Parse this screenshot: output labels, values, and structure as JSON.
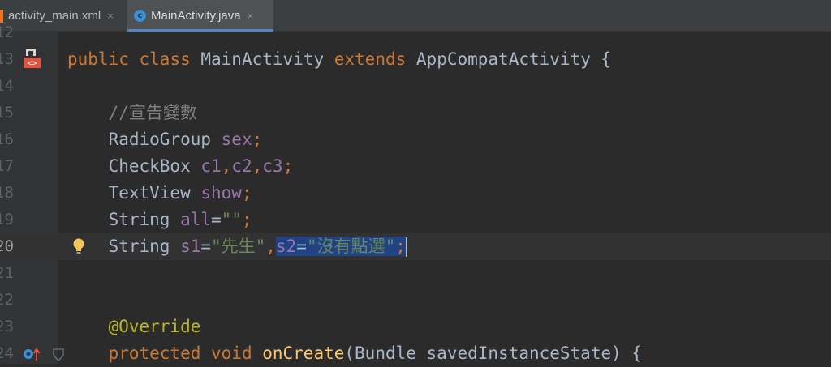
{
  "tabs": [
    {
      "label": "activity_main.xml",
      "close": "×",
      "active": false
    },
    {
      "label": "MainActivity.java",
      "close": "×",
      "active": true,
      "icon_letter": "c"
    }
  ],
  "editor": {
    "lines": [
      {
        "num": "12",
        "tokens": []
      },
      {
        "num": "13",
        "tokens": [
          {
            "t": "public ",
            "c": "kw"
          },
          {
            "t": "class ",
            "c": "kw"
          },
          {
            "t": "MainActivity ",
            "c": "plain"
          },
          {
            "t": "extends ",
            "c": "kw"
          },
          {
            "t": "AppCompatActivity {",
            "c": "plain"
          }
        ]
      },
      {
        "num": "14",
        "tokens": []
      },
      {
        "num": "15",
        "tokens": [
          {
            "t": "    //宣告變數",
            "c": "cmt"
          }
        ]
      },
      {
        "num": "16",
        "tokens": [
          {
            "t": "    RadioGroup ",
            "c": "plain"
          },
          {
            "t": "sex",
            "c": "fld"
          },
          {
            "t": ";",
            "c": "kw"
          }
        ]
      },
      {
        "num": "17",
        "tokens": [
          {
            "t": "    CheckBox ",
            "c": "plain"
          },
          {
            "t": "c1",
            "c": "fld"
          },
          {
            "t": ",",
            "c": "kw"
          },
          {
            "t": "c2",
            "c": "fld"
          },
          {
            "t": ",",
            "c": "kw"
          },
          {
            "t": "c3",
            "c": "fld"
          },
          {
            "t": ";",
            "c": "kw"
          }
        ]
      },
      {
        "num": "18",
        "tokens": [
          {
            "t": "    TextView ",
            "c": "plain"
          },
          {
            "t": "show",
            "c": "fld"
          },
          {
            "t": ";",
            "c": "kw"
          }
        ]
      },
      {
        "num": "19",
        "tokens": [
          {
            "t": "    String ",
            "c": "plain"
          },
          {
            "t": "all",
            "c": "fld"
          },
          {
            "t": "=",
            "c": "plain"
          },
          {
            "t": "\"\"",
            "c": "str"
          },
          {
            "t": ";",
            "c": "kw"
          }
        ]
      },
      {
        "num": "20",
        "current": true,
        "tokens": [
          {
            "t": "    String ",
            "c": "plain"
          },
          {
            "t": "s1",
            "c": "fld"
          },
          {
            "t": "=",
            "c": "plain"
          },
          {
            "t": "\"先生\"",
            "c": "str"
          },
          {
            "t": ",",
            "c": "kw"
          },
          {
            "t": "s2",
            "c": "fld",
            "sel": true
          },
          {
            "t": "=",
            "c": "plain",
            "sel": true
          },
          {
            "t": "\"沒有點選\"",
            "c": "str",
            "sel": true
          },
          {
            "t": ";",
            "c": "kw",
            "sel": true
          }
        ]
      },
      {
        "num": "21",
        "tokens": []
      },
      {
        "num": "22",
        "tokens": []
      },
      {
        "num": "23",
        "tokens": [
          {
            "t": "    @Override",
            "c": "ann"
          }
        ]
      },
      {
        "num": "24",
        "tokens": [
          {
            "t": "    protected ",
            "c": "kw"
          },
          {
            "t": "void ",
            "c": "kw"
          },
          {
            "t": "onCreate",
            "c": "fn"
          },
          {
            "t": "(Bundle savedInstanceState) {",
            "c": "plain"
          }
        ]
      }
    ]
  },
  "colors": {
    "background": "#2b2b2b",
    "gutter": "#313335",
    "keyword": "#cc7832",
    "field": "#9876aa",
    "string": "#6a8759",
    "comment": "#808080",
    "annotation": "#bbb529",
    "method": "#ffc66d",
    "selection": "#214283"
  },
  "gutter_icons": {
    "line13": "layout-xml-icon",
    "line20": "lightbulb-icon",
    "line24": [
      "override-method-icon",
      "fold-icon"
    ]
  }
}
